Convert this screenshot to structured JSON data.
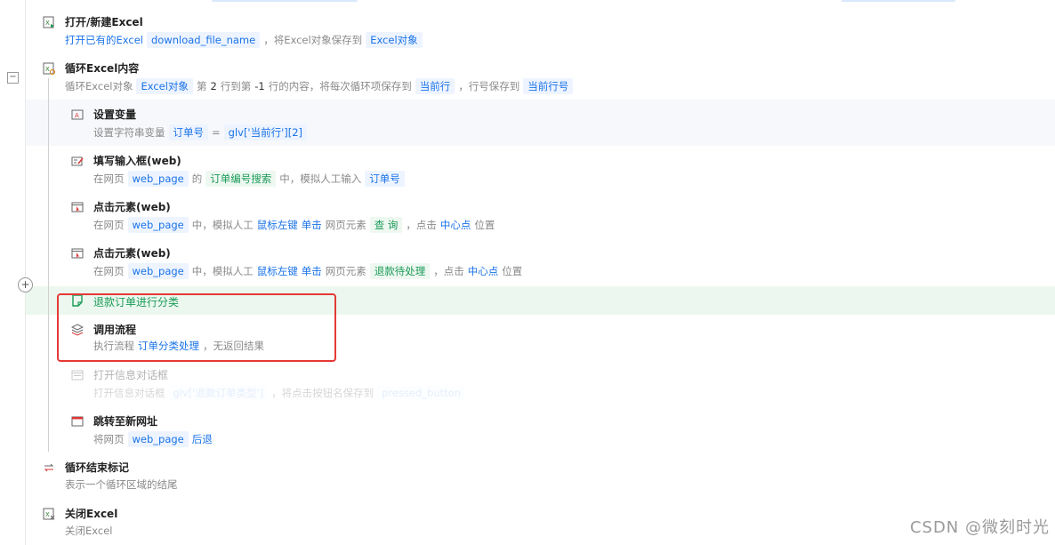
{
  "steps": [
    {
      "title": "打开/新建Excel",
      "desc": [
        {
          "t": "link",
          "v": "打开已有的Excel"
        },
        {
          "t": "tag",
          "v": "download_file_name"
        },
        {
          "t": "plain",
          "v": "，将Excel对象保存到"
        },
        {
          "t": "tag",
          "v": "Excel对象"
        }
      ]
    },
    {
      "title": "循环Excel内容",
      "desc": [
        {
          "t": "plain",
          "v": "循环Excel对象"
        },
        {
          "t": "tag",
          "v": "Excel对象"
        },
        {
          "t": "plain",
          "v": "第"
        },
        {
          "t": "num",
          "v": "2"
        },
        {
          "t": "plain",
          "v": "行到第"
        },
        {
          "t": "num",
          "v": "-1"
        },
        {
          "t": "plain",
          "v": "行的内容，将每次循环项保存到"
        },
        {
          "t": "tag",
          "v": "当前行"
        },
        {
          "t": "plain",
          "v": "，行号保存到"
        },
        {
          "t": "tag",
          "v": "当前行号"
        }
      ]
    },
    {
      "title": "设置变量",
      "desc": [
        {
          "t": "plain",
          "v": "设置字符串变量"
        },
        {
          "t": "tag",
          "v": "订单号"
        },
        {
          "t": "plain",
          "v": "="
        },
        {
          "t": "tag",
          "v": "glv['当前行'][2]"
        }
      ]
    },
    {
      "title": "填写输入框(web)",
      "desc": [
        {
          "t": "plain",
          "v": "在网页"
        },
        {
          "t": "tag",
          "v": "web_page"
        },
        {
          "t": "plain",
          "v": "的"
        },
        {
          "t": "tag-green",
          "v": "订单编号搜索"
        },
        {
          "t": "plain",
          "v": "中，模拟人工输入"
        },
        {
          "t": "tag",
          "v": "订单号"
        }
      ]
    },
    {
      "title": "点击元素(web)",
      "desc": [
        {
          "t": "plain",
          "v": "在网页"
        },
        {
          "t": "tag",
          "v": "web_page"
        },
        {
          "t": "plain",
          "v": "中，模拟人工"
        },
        {
          "t": "link",
          "v": "鼠标左键"
        },
        {
          "t": "link",
          "v": "单击"
        },
        {
          "t": "plain",
          "v": "网页元素"
        },
        {
          "t": "tag-green",
          "v": "查 询"
        },
        {
          "t": "plain",
          "v": "，点击"
        },
        {
          "t": "link",
          "v": "中心点"
        },
        {
          "t": "plain",
          "v": "位置"
        }
      ]
    },
    {
      "title": "点击元素(web)",
      "desc": [
        {
          "t": "plain",
          "v": "在网页"
        },
        {
          "t": "tag",
          "v": "web_page"
        },
        {
          "t": "plain",
          "v": "中，模拟人工"
        },
        {
          "t": "link",
          "v": "鼠标左键"
        },
        {
          "t": "link",
          "v": "单击"
        },
        {
          "t": "plain",
          "v": "网页元素"
        },
        {
          "t": "tag-green",
          "v": "退款待处理"
        },
        {
          "t": "plain",
          "v": "，点击"
        },
        {
          "t": "link",
          "v": "中心点"
        },
        {
          "t": "plain",
          "v": "位置"
        }
      ]
    },
    {
      "title": "退款订单进行分类",
      "desc": []
    },
    {
      "title": "调用流程",
      "desc": [
        {
          "t": "plain",
          "v": "执行流程"
        },
        {
          "t": "link",
          "v": "订单分类处理"
        },
        {
          "t": "plain",
          "v": "，无返回结果"
        }
      ]
    },
    {
      "title": "打开信息对话框",
      "desc": [
        {
          "t": "plain",
          "v": "打开信息对话框"
        },
        {
          "t": "tag",
          "v": "glv['退款订单类型']"
        },
        {
          "t": "plain",
          "v": "，将点击按钮名保存到"
        },
        {
          "t": "tag",
          "v": "pressed_button"
        }
      ]
    },
    {
      "title": "跳转至新网址",
      "desc": [
        {
          "t": "plain",
          "v": "将网页"
        },
        {
          "t": "tag",
          "v": "web_page"
        },
        {
          "t": "link",
          "v": "后退"
        }
      ]
    },
    {
      "title": "循环结束标记",
      "desc": [
        {
          "t": "plain",
          "v": "表示一个循环区域的结尾"
        }
      ]
    },
    {
      "title": "关闭Excel",
      "desc": [
        {
          "t": "plain",
          "v": "关闭Excel"
        }
      ]
    }
  ],
  "controls": {
    "collapse": "−",
    "add": "+"
  },
  "watermark": "CSDN @微刻时光",
  "colors": {
    "accent": "#1a73e8",
    "highlight_border": "#e53935",
    "comment_green": "#1a9a57"
  }
}
